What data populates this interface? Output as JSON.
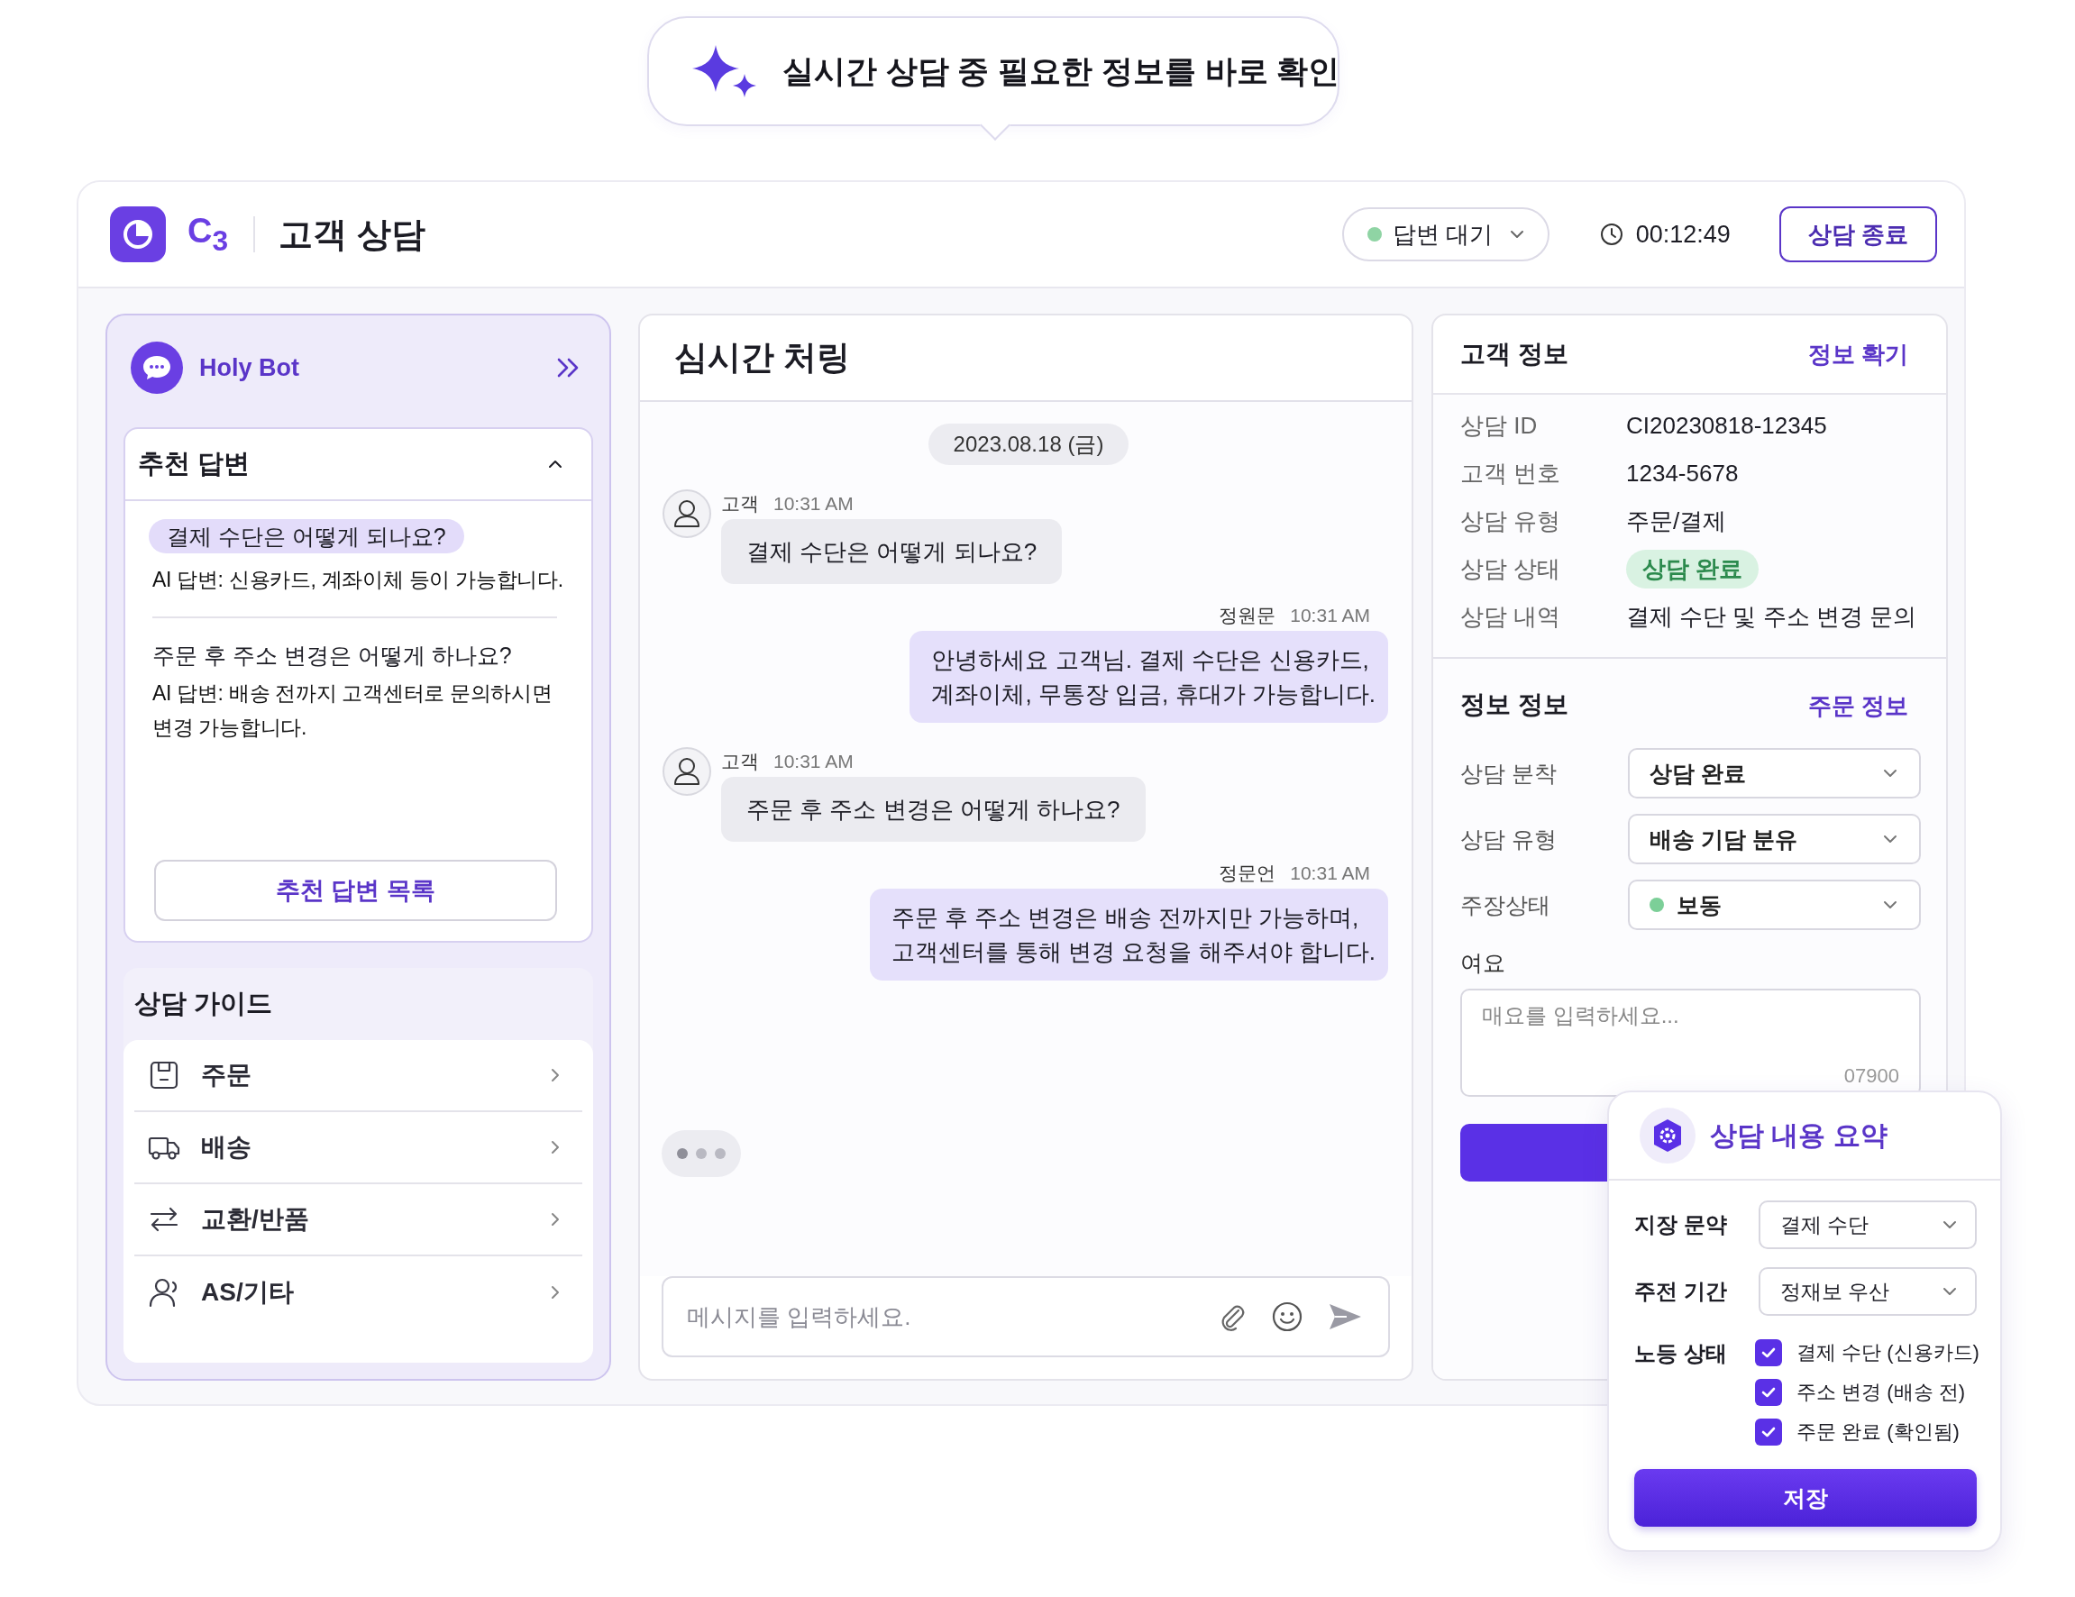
{
  "banner": {
    "text": "실시간 상담 중 필요한 정보를 바로 확인"
  },
  "header": {
    "logo_text": "C$_{3}$",
    "title": "고객 상담",
    "status": {
      "label": "답변 대기",
      "color": "#8fd4a4"
    },
    "timer": "00:12:49",
    "end_button": "상담 종료"
  },
  "bot_panel": {
    "name": "Holy Bot",
    "recommended": {
      "title": "추천 답변",
      "expanded": true,
      "items": [
        {
          "question": "결제 수단은 어떻게 되나요?",
          "answer": "AI 답변: 신용카드, 계좌이체 등이 가능합니다.",
          "selected": true
        },
        {
          "question": "주문 후 주소 변경은 어떻게 하나요?",
          "answer": "AI 답변: 배송 전까지 고객센터로 문의하시면 변경 가능합니다.",
          "selected": false
        }
      ],
      "list_button": "추천 답변 목록"
    },
    "guide": {
      "title": "상담 가이드",
      "items": [
        {
          "label": "주문",
          "kind": "order"
        },
        {
          "label": "배송",
          "kind": "delivery"
        },
        {
          "label": "교환/반품",
          "kind": "exchange"
        },
        {
          "label": "AS/기타",
          "kind": "other"
        }
      ]
    }
  },
  "chat": {
    "title": "심시간 처링",
    "date": "2023.08.18 (금)",
    "messages": [
      {
        "kind": "customer",
        "sender": "고객",
        "time": "10:31 AM",
        "text": "결제 수단은 어떻게 되나요?"
      },
      {
        "kind": "agent",
        "sender": "정원문",
        "time": "10:31 AM",
        "text": "안녕하세요 고객님. 결제 수단은 신용카드,\n계좌이체, 무통장 입금, 휴대가 가능합니다."
      },
      {
        "kind": "customer",
        "sender": "고객",
        "time": "10:31 AM",
        "text": "주문 후 주소 변경은 어떻게 하나요?"
      },
      {
        "kind": "agent",
        "sender": "정문언",
        "time": "10:31 AM",
        "text": "주문 후 주소 변경은 배송 전까지만 가능하며,\n고객센터를 통해 변경 요청을 해주셔야 합니다."
      }
    ],
    "typing": true,
    "input": {
      "placeholder": "메시지를 입력하세요."
    }
  },
  "customer_info": {
    "title": "고객 정보",
    "link": "정보 확기",
    "rows": [
      {
        "label": "상담 ID",
        "value": "CI20230818-12345",
        "kind": "text"
      },
      {
        "label": "고객 번호",
        "value": "1234-5678",
        "kind": "text"
      },
      {
        "label": "상담 유형",
        "value": "주문/결제",
        "kind": "text"
      },
      {
        "label": "상담 상태",
        "value": "상담 완료",
        "kind": "badge"
      },
      {
        "label": "상담 내역",
        "value": "결제 수단 및 주소 변경 문의",
        "kind": "text"
      }
    ]
  },
  "consult_info": {
    "title": "정보 정보",
    "link": "주문 정보",
    "fields": [
      {
        "label": "상담 분착",
        "value": "상담 완료"
      },
      {
        "label": "상담 유형",
        "value": "배송 기담 분유"
      },
      {
        "label": "주장상태",
        "value": "보동",
        "color": "#7ccf98"
      }
    ],
    "memo": {
      "label": "여요",
      "placeholder": "매요를 입력하세요...",
      "counter": "07900"
    }
  },
  "summary": {
    "title": "상담 내용 요약",
    "fields": [
      {
        "label": "지장 문약",
        "value": "결제 수단"
      },
      {
        "label": "주전 기간",
        "value": "정재보 우산"
      }
    ],
    "checks_label": "노등 상태",
    "checks": [
      {
        "label": "결제 수단 (신용카드)",
        "checked": true
      },
      {
        "label": "주소 변경 (배송 전)",
        "checked": true
      },
      {
        "label": "주문 완료 (확인됨)",
        "checked": true
      }
    ],
    "save_button": "저장"
  }
}
